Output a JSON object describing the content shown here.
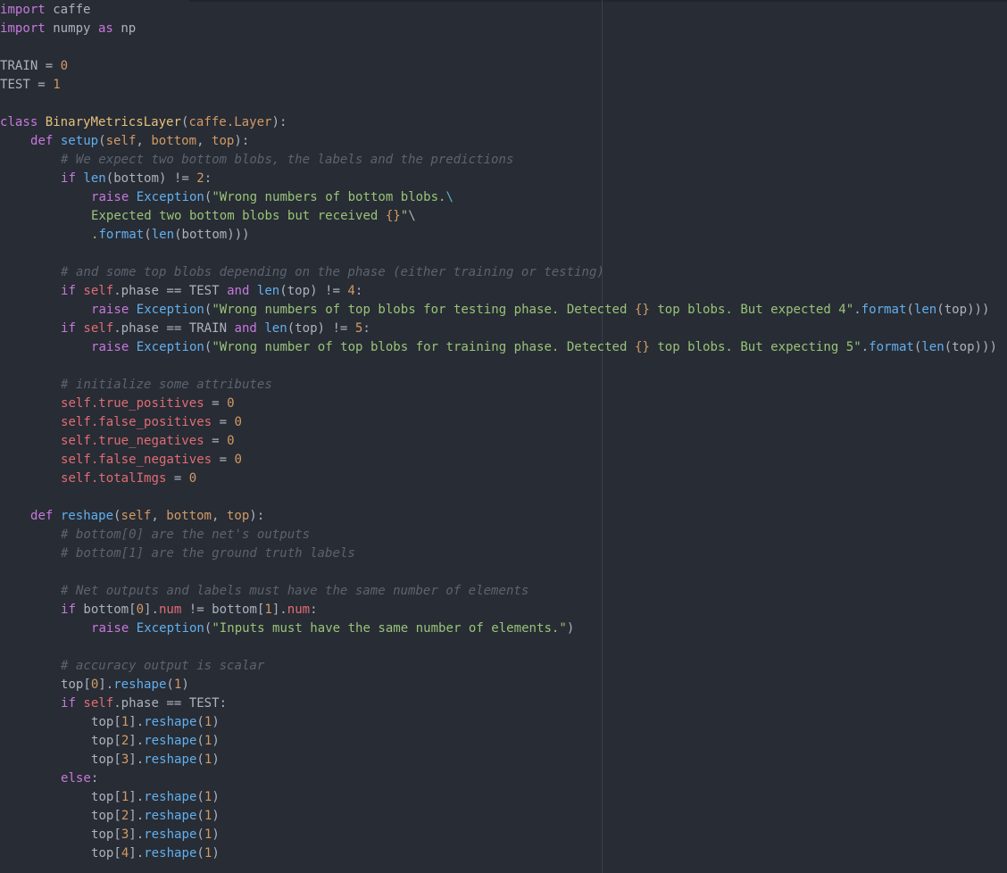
{
  "code": {
    "l1": {
      "a": "import",
      "b": " caffe"
    },
    "l2": {
      "a": "import",
      "b": " numpy ",
      "c": "as",
      "d": " np"
    },
    "l4": {
      "a": "TRAIN = ",
      "b": "0"
    },
    "l5": {
      "a": "TEST = ",
      "b": "1"
    },
    "l7": {
      "a": "class ",
      "b": "BinaryMetricsLayer",
      "c": "(",
      "d": "caffe",
      "e": ".Layer",
      "f": "):"
    },
    "l8": {
      "a": "def ",
      "b": "setup",
      "c": "(",
      "d": "self",
      "e": ", ",
      "f": "bottom",
      "g": ", ",
      "h": "top",
      "i": "):"
    },
    "l9": {
      "a": "# We expect two bottom blobs, the labels and the predictions"
    },
    "l10": {
      "a": "if ",
      "b": "len",
      "c": "(bottom) != ",
      "d": "2",
      "e": ":"
    },
    "l11": {
      "a": "raise ",
      "b": "Exception",
      "c": "(",
      "d": "\"Wrong numbers of bottom blobs.",
      "e": "\\"
    },
    "l12": {
      "a": "Expected two bottom blobs but received ",
      "b": "{}",
      "c": "\"",
      "d": "\\"
    },
    "l13": {
      "a": ".",
      "b": "format",
      "c": "(",
      "d": "len",
      "e": "(bottom)))"
    },
    "l15": {
      "a": "# and some top blobs depending on the phase (either training or testing)"
    },
    "l16": {
      "a": "if ",
      "b": "self",
      "c": ".phase == TEST ",
      "d": "and ",
      "e": "len",
      "f": "(top) != ",
      "g": "4",
      "h": ":"
    },
    "l17": {
      "a": "raise ",
      "b": "Exception",
      "c": "(",
      "d": "\"Wrong numbers of top blobs for testing phase. Detected ",
      "e": "{}",
      "f": " top blobs. But expected 4\"",
      "g": ".",
      "h": "format",
      "i": "(",
      "j": "len",
      "k": "(top)))"
    },
    "l18": {
      "a": "if ",
      "b": "self",
      "c": ".phase == TRAIN ",
      "d": "and ",
      "e": "len",
      "f": "(top) != ",
      "g": "5",
      "h": ":"
    },
    "l19": {
      "a": "raise ",
      "b": "Exception",
      "c": "(",
      "d": "\"Wrong number of top blobs for training phase. Detected ",
      "e": "{}",
      "f": " top blobs. But expecting 5\"",
      "g": ".",
      "h": "format",
      "i": "(",
      "j": "len",
      "k": "(top)))"
    },
    "l21": {
      "a": "# initialize some attributes"
    },
    "l22": {
      "a": "self",
      "b": ".true_positives",
      "c": " = ",
      "d": "0"
    },
    "l23": {
      "a": "self",
      "b": ".false_positives",
      "c": " = ",
      "d": "0"
    },
    "l24": {
      "a": "self",
      "b": ".true_negatives",
      "c": " = ",
      "d": "0"
    },
    "l25": {
      "a": "self",
      "b": ".false_negatives",
      "c": " = ",
      "d": "0"
    },
    "l26": {
      "a": "self",
      "b": ".totalImgs",
      "c": " = ",
      "d": "0"
    },
    "l28": {
      "a": "def ",
      "b": "reshape",
      "c": "(",
      "d": "self",
      "e": ", ",
      "f": "bottom",
      "g": ", ",
      "h": "top",
      "i": "):"
    },
    "l29": {
      "a": "# bottom[0] are the net's outputs"
    },
    "l30": {
      "a": "# bottom[1] are the ground truth labels"
    },
    "l32": {
      "a": "# Net outputs and labels must have the same number of elements"
    },
    "l33": {
      "a": "if ",
      "b": "bottom[",
      "c": "0",
      "d": "].",
      "e": "num",
      "f": " != bottom[",
      "g": "1",
      "h": "].",
      "i": "num",
      "j": ":"
    },
    "l34": {
      "a": "raise ",
      "b": "Exception",
      "c": "(",
      "d": "\"Inputs must have the same number of elements.\"",
      "e": ")"
    },
    "l36": {
      "a": "# accuracy output is scalar"
    },
    "l37": {
      "a": "top[",
      "b": "0",
      "c": "].",
      "d": "reshape",
      "e": "(",
      "f": "1",
      "g": ")"
    },
    "l38": {
      "a": "if ",
      "b": "self",
      "c": ".phase == TEST:"
    },
    "l39": {
      "a": "top[",
      "b": "1",
      "c": "].",
      "d": "reshape",
      "e": "(",
      "f": "1",
      "g": ")"
    },
    "l40": {
      "a": "top[",
      "b": "2",
      "c": "].",
      "d": "reshape",
      "e": "(",
      "f": "1",
      "g": ")"
    },
    "l41": {
      "a": "top[",
      "b": "3",
      "c": "].",
      "d": "reshape",
      "e": "(",
      "f": "1",
      "g": ")"
    },
    "l42": {
      "a": "else",
      "b": ":"
    },
    "l43": {
      "a": "top[",
      "b": "1",
      "c": "].",
      "d": "reshape",
      "e": "(",
      "f": "1",
      "g": ")"
    },
    "l44": {
      "a": "top[",
      "b": "2",
      "c": "].",
      "d": "reshape",
      "e": "(",
      "f": "1",
      "g": ")"
    },
    "l45": {
      "a": "top[",
      "b": "3",
      "c": "].",
      "d": "reshape",
      "e": "(",
      "f": "1",
      "g": ")"
    },
    "l46": {
      "a": "top[",
      "b": "4",
      "c": "].",
      "d": "reshape",
      "e": "(",
      "f": "1",
      "g": ")"
    }
  },
  "colors": {
    "background": "#282c34",
    "keyword": "#c678dd",
    "function": "#61afef",
    "class": "#e5c07b",
    "string": "#98c379",
    "number": "#d19a66",
    "self": "#e06c75",
    "comment": "#5c6370",
    "text": "#abb2bf"
  }
}
